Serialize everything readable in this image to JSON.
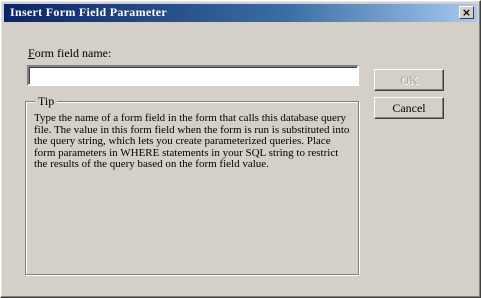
{
  "window": {
    "title": "Insert Form Field Parameter",
    "close_glyph": "×"
  },
  "field": {
    "label_underlined": "F",
    "label_rest": "orm field name:",
    "value": "",
    "placeholder": ""
  },
  "tip": {
    "legend": "Tip",
    "text": "Type the name of a form field in the form that calls this database query file. The value in this form field when the form is run is substituted into the query string, which lets you create parameterized queries. Place form parameters in WHERE statements in your SQL string to restrict the results of the query based on the form field value."
  },
  "buttons": {
    "ok_label": "OK",
    "ok_enabled": false,
    "cancel_label": "Cancel"
  },
  "colors": {
    "title_start": "#0a246a",
    "title_end": "#a6caf0",
    "face": "#d4d0c8"
  },
  "icons": {
    "close": "close-icon"
  }
}
